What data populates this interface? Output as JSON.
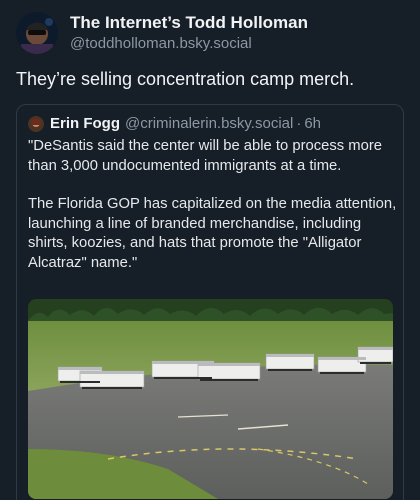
{
  "post": {
    "author": {
      "display_name": "The Internet’s Todd Holloman",
      "handle": "@toddholloman.bsky.social"
    },
    "text": "They’re selling concentration camp merch.",
    "quote": {
      "author": {
        "display_name": "Erin Fogg",
        "handle": "@criminalerin.bsky.social",
        "separator": "·",
        "time": "6h"
      },
      "paragraphs": [
        "\"DeSantis said the center will be able to process more than 3,000 undocumented immigrants at a time.",
        "The Florida GOP has capitalized on the media attention, launching a line of branded merchandise, including shirts, koozies, and hats that promote the \"Alligator Alcatraz\" name.\""
      ]
    }
  },
  "colors": {
    "background": "#161e27",
    "text_primary": "#f1f3f5",
    "text_secondary": "#8d98a5",
    "border": "#2e3a47"
  }
}
